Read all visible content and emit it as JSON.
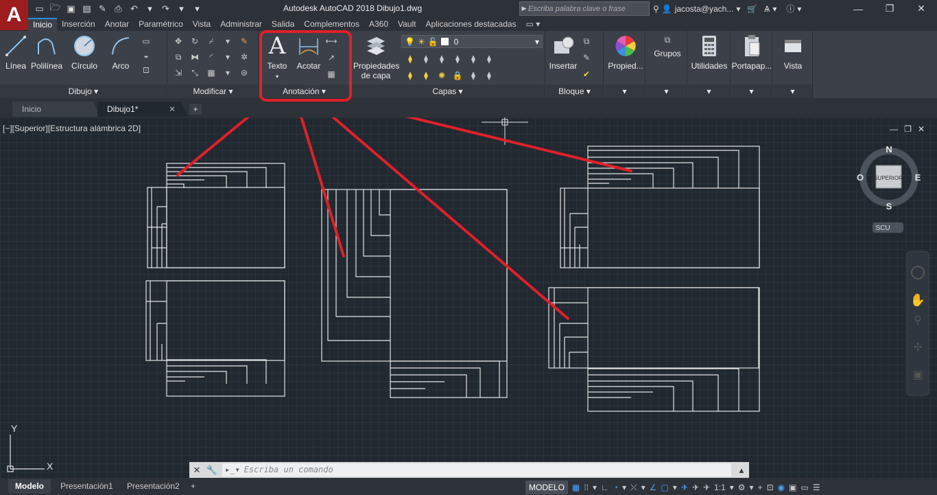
{
  "app": {
    "logo": "A",
    "title": "Autodesk AutoCAD 2018    Dibujo1.dwg",
    "search_placeholder": "Escriba palabra clave o frase",
    "user": "jacosta@yach..."
  },
  "ribbon_tabs": [
    "Inicio",
    "Inserción",
    "Anotar",
    "Paramétrico",
    "Vista",
    "Administrar",
    "Salida",
    "Complementos",
    "A360",
    "Vault",
    "Aplicaciones destacadas"
  ],
  "active_tab": "Inicio",
  "panels": {
    "dibujo": {
      "title": "Dibujo",
      "buttons": [
        "Línea",
        "Polilínea",
        "Círculo",
        "Arco"
      ]
    },
    "modificar": {
      "title": "Modificar"
    },
    "anotacion": {
      "title": "Anotación",
      "buttons": [
        "Texto",
        "Acotar"
      ]
    },
    "capas": {
      "title": "Capas",
      "props_line1": "Propiedades",
      "props_line2": "de capa",
      "current_layer": "0"
    },
    "bloque": {
      "title": "Bloque",
      "button": "Insertar"
    },
    "propiedades": {
      "button": "Propied..."
    },
    "grupos": {
      "button": "Grupos"
    },
    "utilidades": {
      "button": "Utilidades"
    },
    "portapapeles": {
      "button": "Portapap..."
    },
    "vista": {
      "button": "Vista"
    }
  },
  "file_tabs": [
    "Inicio",
    "Dibujo1*"
  ],
  "viewport": {
    "label": "[−][Superior][Estructura alámbrica 2D]",
    "viewcube": {
      "n": "N",
      "s": "S",
      "e": "E",
      "o": "O",
      "face": "SUPERIOR",
      "ucs": "SCU"
    },
    "ucs_x": "X",
    "ucs_y": "Y"
  },
  "command": {
    "placeholder": "Escriba un comando"
  },
  "layout_tabs": [
    "Modelo",
    "Presentación1",
    "Presentación2"
  ],
  "status": {
    "model": "MODELO",
    "scale": "1:1"
  },
  "colors": {
    "accent": "#2a8cd8",
    "highlight": "#e0202a",
    "logo": "#9d1d1f"
  }
}
